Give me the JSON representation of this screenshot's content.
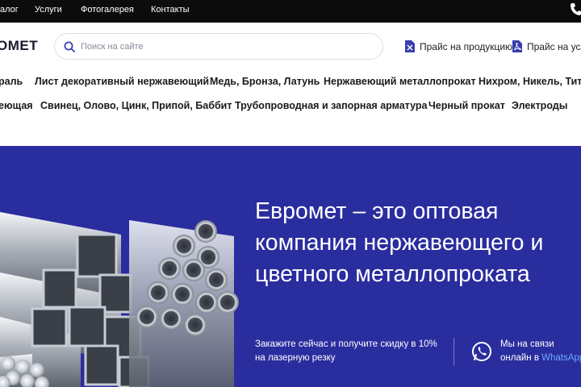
{
  "topbar": {
    "nav": [
      "алог",
      "Услуги",
      "Фотогалерея",
      "Контакты"
    ]
  },
  "header": {
    "logo": "ОМЕТ",
    "search_placeholder": "Поиск на сайте",
    "price_links": [
      "Прайс на продукцию",
      "Прайс на услу"
    ]
  },
  "categories": {
    "row1": [
      "раль",
      "Лист декоративный нержавеющий",
      "Медь, Бронза, Латунь",
      "Нержавеющий металлопрокат",
      "Нихром, Никель, Тита"
    ],
    "row2": [
      "еющая",
      "Свинец, Олово, Цинк, Припой, Баббит",
      "Трубопроводная и запорная арматура",
      "Черный прокат",
      "Электроды"
    ]
  },
  "hero": {
    "title": "Евромет – это оптовая компания нержавеющего и цветного металлопроката",
    "promo": "Закажите сейчас и получите скидку в 10% на лазерную резку",
    "contact_line1": "Мы на связи",
    "contact_line2_prefix": "онлайн в ",
    "contact_line2_link": "WhatsApp"
  },
  "colors": {
    "hero_bg": "#2a2d9e",
    "accent": "#3a3fb0",
    "topbar_bg": "#0c0c0c"
  },
  "icons": [
    "phone-icon",
    "search-icon",
    "excel-file-icon",
    "pdf-file-icon",
    "whatsapp-icon"
  ]
}
